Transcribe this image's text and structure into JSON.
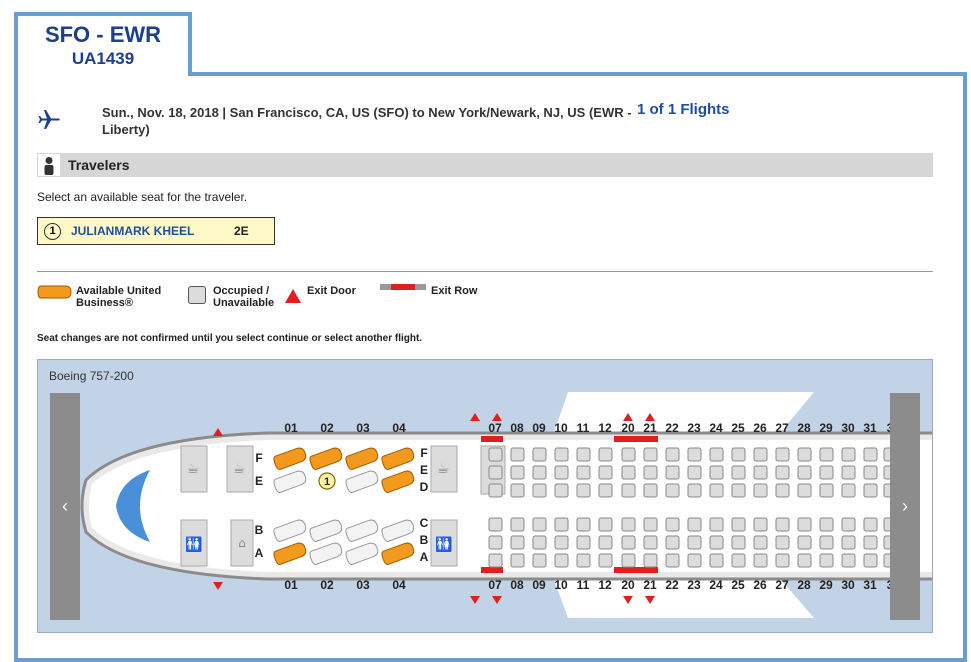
{
  "header": {
    "route": "SFO - EWR",
    "flight_number": "UA1439"
  },
  "flight": {
    "description": "Sun., Nov. 18, 2018 | San Francisco, CA, US (SFO) to New York/Newark, NJ, US (EWR - Liberty)",
    "count": "1 of 1 Flights"
  },
  "travelers": {
    "title": "Travelers",
    "instruction": "Select an available seat for the traveler.",
    "list": [
      {
        "number": "1",
        "name": "JULIANMARK KHEEL",
        "seat": "2E"
      }
    ]
  },
  "legend": {
    "available": "Available United Business®",
    "occupied": "Occupied / Unavailable",
    "exit_door": "Exit Door",
    "exit_row": "Exit Row"
  },
  "notice": "Seat changes are not confirmed until you select continue or select another flight.",
  "seatmap": {
    "aircraft": "Boeing 757-200",
    "first_rows": [
      "01",
      "02",
      "03",
      "04"
    ],
    "economy_rows": [
      "07",
      "08",
      "09",
      "10",
      "11",
      "12",
      "20",
      "21",
      "22",
      "23",
      "24",
      "25",
      "26",
      "27",
      "28",
      "29",
      "30",
      "31",
      "3"
    ],
    "exit_rows": [
      "07",
      "20",
      "21"
    ],
    "first_left_letters": [
      "F",
      "E",
      "B",
      "A"
    ],
    "first_right_letters": [
      "F",
      "E",
      "D",
      "C",
      "B",
      "A"
    ],
    "available_first": [
      "1F",
      "2F",
      "3F",
      "4F",
      "4E",
      "1A",
      "4A"
    ],
    "selected_seat": {
      "seat": "2E",
      "traveler": "1"
    },
    "colors": {
      "available": "#f39a1e",
      "occupied": "#dcdcdc",
      "exit": "#e02020",
      "panel": "#6b9dd0"
    },
    "nav": {
      "prev": "‹",
      "next": "›"
    }
  }
}
